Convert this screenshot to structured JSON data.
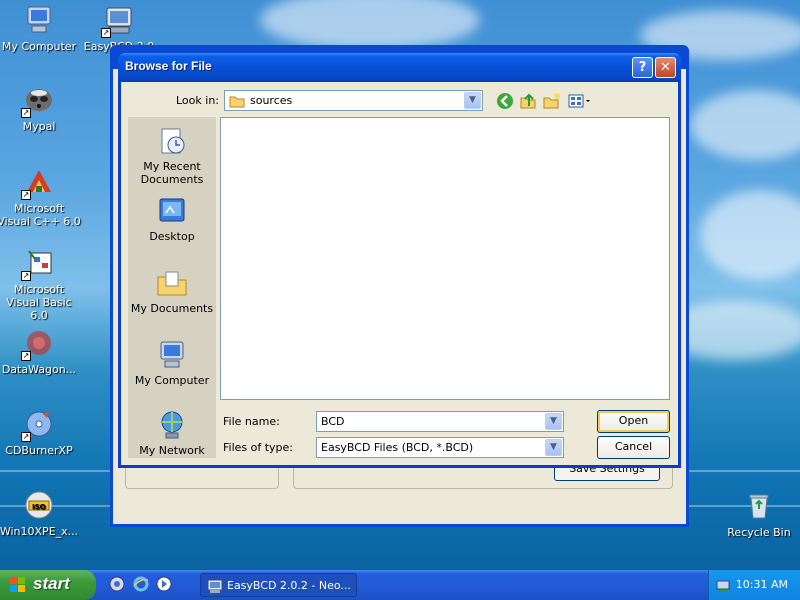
{
  "desktop": {
    "icons": [
      {
        "label": "My Computer"
      },
      {
        "label": "EasyBCD 2.0"
      },
      {
        "label": "Mypal"
      },
      {
        "label": "Microsoft Visual C++ 6.0"
      },
      {
        "label": "Microsoft Visual Basic 6.0"
      },
      {
        "label": "DataWagon..."
      },
      {
        "label": "CDBurnerXP"
      },
      {
        "label": "Win10XPE_x..."
      },
      {
        "label": "Recycle Bin"
      }
    ]
  },
  "background_window": {
    "button_label": "Save Settings"
  },
  "dialog": {
    "title": "Browse for File",
    "help_symbol": "?",
    "close_symbol": "✕",
    "look_in_label": "Look in:",
    "look_in_value": "sources",
    "places": [
      {
        "label": "My Recent Documents"
      },
      {
        "label": "Desktop"
      },
      {
        "label": "My Documents"
      },
      {
        "label": "My Computer"
      },
      {
        "label": "My Network"
      }
    ],
    "file_name_label": "File name:",
    "file_name_value": "BCD",
    "files_of_type_label": "Files of type:",
    "files_of_type_value": "EasyBCD Files (BCD, *.BCD)",
    "open_label": "Open",
    "cancel_label": "Cancel"
  },
  "taskbar": {
    "start_label": "start",
    "task_label": "EasyBCD 2.0.2  - Neo...",
    "clock": "10:31 AM"
  },
  "colors": {
    "titlebar": "#0750d8",
    "dialog_bg": "#ece9d8",
    "taskbar": "#245edb",
    "start_button": "#3c9a3c"
  }
}
